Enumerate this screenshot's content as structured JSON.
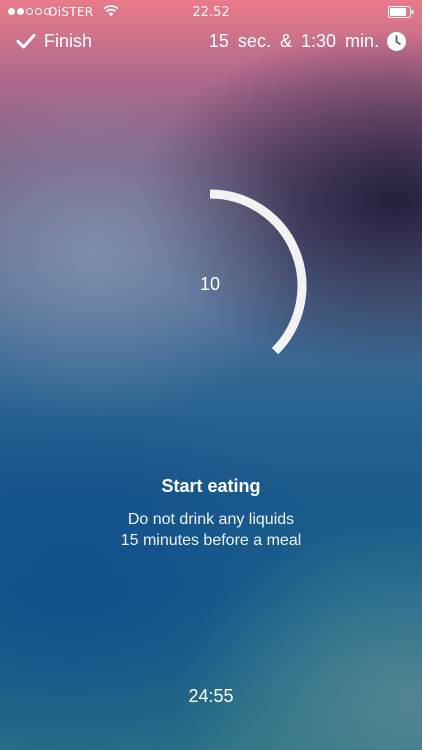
{
  "status_bar": {
    "carrier": "OiSTER",
    "time": "22.52",
    "signal_bars_filled": 2,
    "signal_bars_total": 5,
    "battery_level": 0.85
  },
  "nav": {
    "finish_label": "Finish",
    "finish_icon": "checkmark-icon",
    "interval_text": "15 sec. & 1:30 min.",
    "interval_icon": "clock-icon"
  },
  "timer": {
    "countdown": "10",
    "progress_fraction": 0.375
  },
  "message": {
    "title": "Start eating",
    "line1": "Do not drink any liquids",
    "line2": "15 minutes before a meal"
  },
  "remaining": "24:55"
}
